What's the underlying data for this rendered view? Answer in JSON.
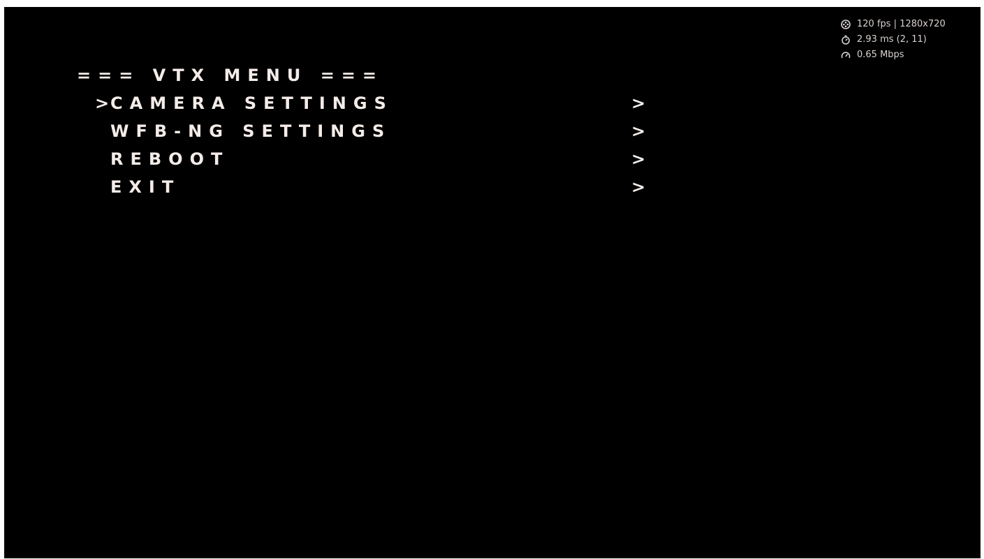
{
  "menu": {
    "title": "=== VTX MENU ===",
    "cursor": ">",
    "items": [
      {
        "label": "CAMERA SETTINGS",
        "arrow": ">",
        "selected": true
      },
      {
        "label": "WFB-NG SETTINGS",
        "arrow": ">",
        "selected": false
      },
      {
        "label": "REBOOT",
        "arrow": ">",
        "selected": false
      },
      {
        "label": "EXIT",
        "arrow": ">",
        "selected": false
      }
    ]
  },
  "stats": {
    "fps_resolution": "120 fps | 1280x720",
    "latency": "2.93 ms (2, 11)",
    "bitrate": "0.65 Mbps",
    "icons": [
      "film-reel-icon",
      "timer-icon",
      "speedometer-icon"
    ]
  },
  "colors": {
    "background": "#000000",
    "menu_text": "#f3ece9",
    "stats_text": "#d9d2cf"
  }
}
